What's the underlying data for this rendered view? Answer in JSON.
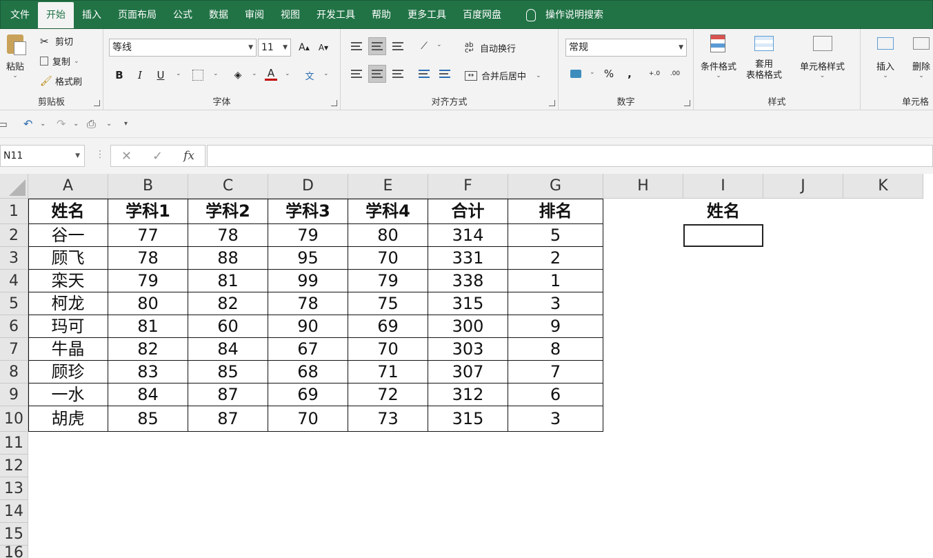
{
  "menu": {
    "tabs": [
      "文件",
      "开始",
      "插入",
      "页面布局",
      "公式",
      "数据",
      "审阅",
      "视图",
      "开发工具",
      "帮助",
      "更多工具",
      "百度网盘"
    ],
    "active_index": 1,
    "search_label": "操作说明搜索"
  },
  "ribbon": {
    "clipboard": {
      "label": "剪贴板",
      "paste": "粘贴",
      "cut": "剪切",
      "copy": "复制",
      "format_painter": "格式刷"
    },
    "font": {
      "label": "字体",
      "name": "等线",
      "size": "11",
      "grow": "A",
      "shrink": "A",
      "bold": "B",
      "italic": "I",
      "underline": "U",
      "font_color": "A",
      "phonetic": "文"
    },
    "alignment": {
      "label": "对齐方式",
      "wrap": "自动换行",
      "merge": "合并后居中"
    },
    "number": {
      "label": "数字",
      "format": "常规",
      "percent": "%",
      "comma": ",",
      "inc_dec": "+.0",
      "dec_dec": ".00"
    },
    "styles": {
      "label": "样式",
      "conditional": "条件格式",
      "table_format_1": "套用",
      "table_format_2": "表格格式",
      "cell_styles": "单元格样式"
    },
    "cells": {
      "label": "单元格",
      "insert": "插入",
      "delete": "删除"
    }
  },
  "formula_bar": {
    "name_box": "N11",
    "fx": "fx",
    "value": ""
  },
  "grid": {
    "columns": [
      "A",
      "B",
      "C",
      "D",
      "E",
      "F",
      "G",
      "H",
      "I",
      "J",
      "K"
    ],
    "rows": [
      "1",
      "2",
      "3",
      "4",
      "5",
      "6",
      "7",
      "8",
      "9",
      "10",
      "11",
      "12",
      "13",
      "14",
      "15",
      "16"
    ],
    "header": [
      "姓名",
      "学科1",
      "学科2",
      "学科3",
      "学科4",
      "合计",
      "排名"
    ],
    "data": [
      [
        "谷一",
        "77",
        "78",
        "79",
        "80",
        "314",
        "5"
      ],
      [
        "顾飞",
        "78",
        "88",
        "95",
        "70",
        "331",
        "2"
      ],
      [
        "栾天",
        "79",
        "81",
        "99",
        "79",
        "338",
        "1"
      ],
      [
        "柯龙",
        "80",
        "82",
        "78",
        "75",
        "315",
        "3"
      ],
      [
        "玛可",
        "81",
        "60",
        "90",
        "69",
        "300",
        "9"
      ],
      [
        "牛晶",
        "82",
        "84",
        "67",
        "70",
        "303",
        "8"
      ],
      [
        "顾珍",
        "83",
        "85",
        "68",
        "71",
        "307",
        "7"
      ],
      [
        "一水",
        "84",
        "87",
        "69",
        "72",
        "312",
        "6"
      ],
      [
        "胡虎",
        "85",
        "87",
        "70",
        "73",
        "315",
        "3"
      ]
    ],
    "lookup_label": "姓名",
    "lookup_value": ""
  },
  "colors": {
    "brand": "#217346"
  }
}
